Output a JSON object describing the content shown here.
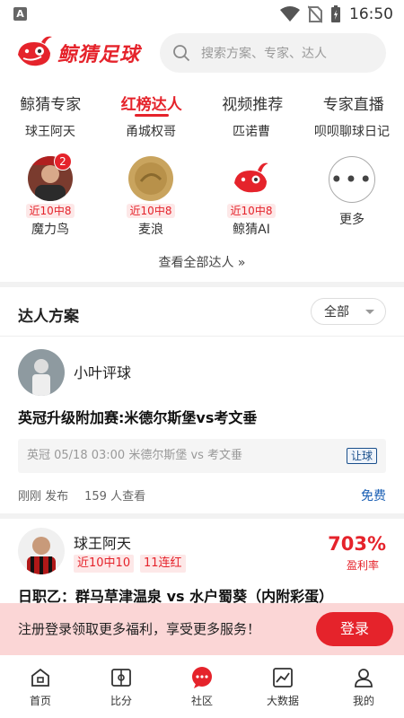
{
  "status_bar": {
    "time": "16:50"
  },
  "header": {
    "logo_text": "鲸猜足球",
    "search_placeholder": "搜索方案、专家、达人"
  },
  "tabs": [
    {
      "label": "鲸猜专家"
    },
    {
      "label": "红榜达人",
      "active": true
    },
    {
      "label": "视频推荐"
    },
    {
      "label": "专家直播"
    }
  ],
  "experts_row1": [
    {
      "name": "球王阿天"
    },
    {
      "name": "甬城权哥"
    },
    {
      "name": "匹诺曹"
    },
    {
      "name": "呗呗聊球日记"
    }
  ],
  "experts_row2": [
    {
      "name": "魔力鸟",
      "hit": "近10中8",
      "badge": "2"
    },
    {
      "name": "麦浪",
      "hit": "近10中8"
    },
    {
      "name": "鲸猜AI",
      "hit": "近10中8"
    }
  ],
  "more_label": "更多",
  "view_all": "查看全部达人 »",
  "section": {
    "title": "达人方案",
    "filter": "全部"
  },
  "post1": {
    "author": "小叶评球",
    "title": "英冠升级附加赛:米德尔斯堡vs考文垂",
    "match": "英冠 05/18 03:00 米德尔斯堡 vs 考文垂",
    "match_tag": "让球",
    "published": "刚刚 发布",
    "views": "159 人查看",
    "price": "免费"
  },
  "post2": {
    "author": "球王阿天",
    "tags": [
      "近10中10",
      "11连红"
    ],
    "rate": "703%",
    "rate_label": "盈利率",
    "title": "日职乙：群马草津温泉 vs 水户蜀葵（内附彩蛋）"
  },
  "banner": {
    "text": "注册登录领取更多福利，享受更多服务！",
    "button": "登录"
  },
  "nav": [
    {
      "label": "首页",
      "icon": "home-icon"
    },
    {
      "label": "比分",
      "icon": "score-icon"
    },
    {
      "label": "社区",
      "icon": "community-icon"
    },
    {
      "label": "大数据",
      "icon": "chart-icon"
    },
    {
      "label": "我的",
      "icon": "profile-icon"
    }
  ],
  "colors": {
    "accent": "#e5232b",
    "banner_bg": "#fbd6d6",
    "link_blue": "#1a5fb4"
  }
}
